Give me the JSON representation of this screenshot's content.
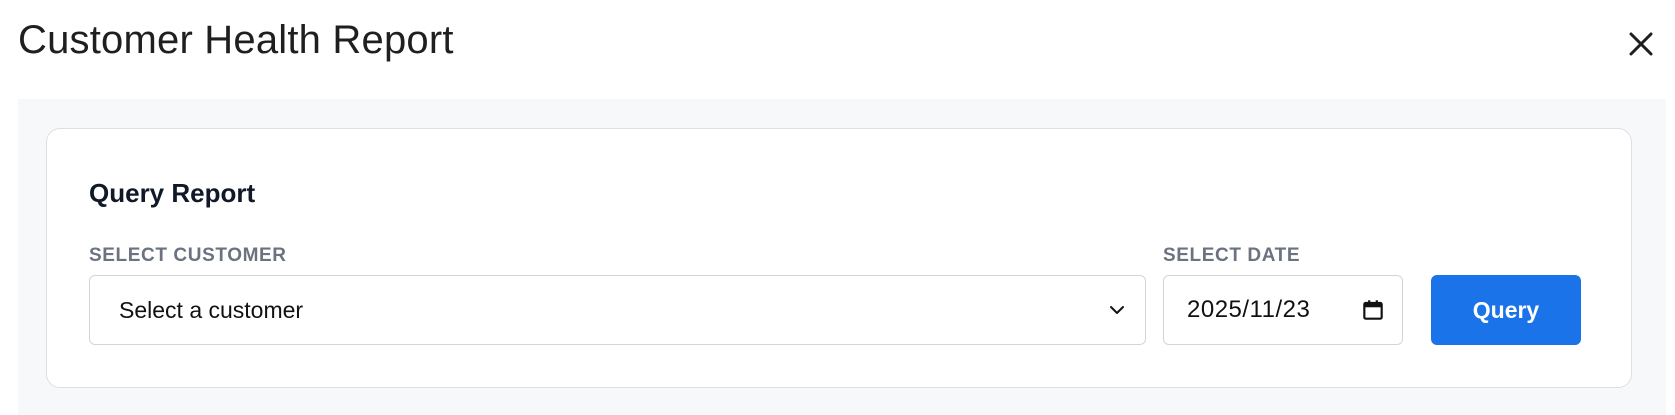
{
  "dialog": {
    "title": "Customer Health Report",
    "close_icon": "close-icon"
  },
  "query_card": {
    "title": "Query Report",
    "customer": {
      "label": "SELECT CUSTOMER",
      "selected_value": "Select a customer",
      "icon": "chevron-down-icon"
    },
    "date": {
      "label": "SELECT DATE",
      "value": "2025/11/23",
      "icon": "calendar-icon"
    },
    "query_button_label": "Query"
  },
  "colors": {
    "primary_button": "#1a73e8",
    "panel_background": "#f7f8fa",
    "label_gray": "#6b7280",
    "border": "#d1d5db"
  }
}
